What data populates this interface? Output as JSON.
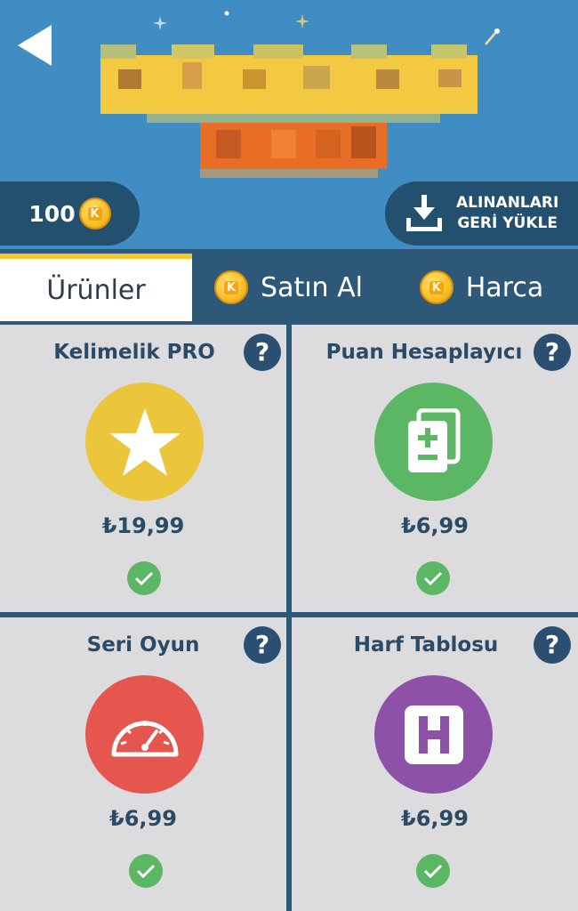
{
  "header": {
    "coins": "100",
    "restore_line1": "ALINANLARI",
    "restore_line2": "GERİ YÜKLE"
  },
  "tabs": [
    {
      "label": "Ürünler",
      "active": true
    },
    {
      "label": "Satın Al",
      "active": false
    },
    {
      "label": "Harca",
      "active": false
    }
  ],
  "products": [
    {
      "title": "Kelimelik PRO",
      "price": "₺19,99",
      "icon": "star-icon",
      "color": "#ebc53b",
      "purchased": true
    },
    {
      "title": "Puan Hesaplayıcı",
      "price": "₺6,99",
      "icon": "score-cards-icon",
      "color": "#5cb765",
      "purchased": true
    },
    {
      "title": "Seri Oyun",
      "price": "₺6,99",
      "icon": "speedometer-icon",
      "color": "#e5564f",
      "purchased": true
    },
    {
      "title": "Harf Tablosu",
      "price": "₺6,99",
      "icon": "letter-h-icon",
      "color": "#8e51a8",
      "purchased": true
    }
  ],
  "help_label": "?",
  "colors": {
    "header_bg": "#3f8dc3",
    "dark_blue": "#2d5878",
    "accent_yellow": "#f4c72e",
    "card_bg": "#dcdcde",
    "check_green": "#5cb765"
  }
}
